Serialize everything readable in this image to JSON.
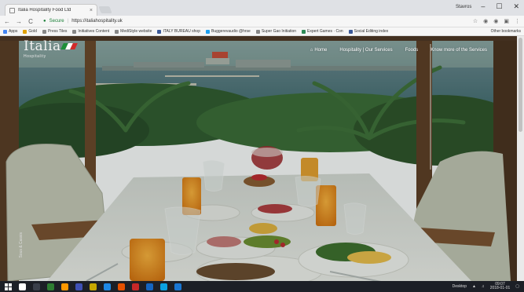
{
  "browser": {
    "tab_title": "Italia Hospitality Food Ltd",
    "tab_close": "×",
    "profile_name": "Stavros",
    "win_min": "–",
    "win_max": "☐",
    "win_close": "✕",
    "secure_label": "Secure",
    "url": "https://italiahospitality.uk",
    "nav_back": "←",
    "nav_forward": "→",
    "nav_reload": "C",
    "star_icon": "☆",
    "bookmarks": [
      {
        "label": "Apps",
        "color": "#4285f4"
      },
      {
        "label": "Gold",
        "color": "#e0a100"
      },
      {
        "label": "Press Tiles",
        "color": "#888888"
      },
      {
        "label": "Initiatives Content",
        "color": "#888888"
      },
      {
        "label": "MediStyle website",
        "color": "#888888"
      },
      {
        "label": "ITALY BUREAU shop",
        "color": "#3b5998"
      },
      {
        "label": "Buggerevaudio @hrse",
        "color": "#1da1f2"
      },
      {
        "label": "Super Gao Initiation",
        "color": "#888888"
      },
      {
        "label": "Expert Games · Con",
        "color": "#2e8b57"
      },
      {
        "label": "Social Editing index",
        "color": "#3b5998"
      }
    ],
    "bookmarks_right": "Other bookmarks"
  },
  "site": {
    "logo_word": "Italia",
    "logo_sub": "Hospitality",
    "flag_colors": [
      "#1f8f3a",
      "#ffffff",
      "#d12a2a"
    ],
    "nav": [
      {
        "label": "Home",
        "icon": "home-icon"
      },
      {
        "label": "Hospitality | Our Services"
      },
      {
        "label": "Foods"
      },
      {
        "label": "Know more of the Services"
      }
    ],
    "side_caption": "Sous & Cassis"
  },
  "taskbar": {
    "apps": [
      "#ffffff",
      "#3a3f4a",
      "#2e7d32",
      "#ff9800",
      "#3f51b5",
      "#c6a700",
      "#1e88e5",
      "#e65100",
      "#c62828",
      "#1565c0",
      "#0aa1e0",
      "#1976d2"
    ],
    "tray_text": "Desktop",
    "clock_time": "09:07",
    "clock_date": "2018-01-01"
  }
}
